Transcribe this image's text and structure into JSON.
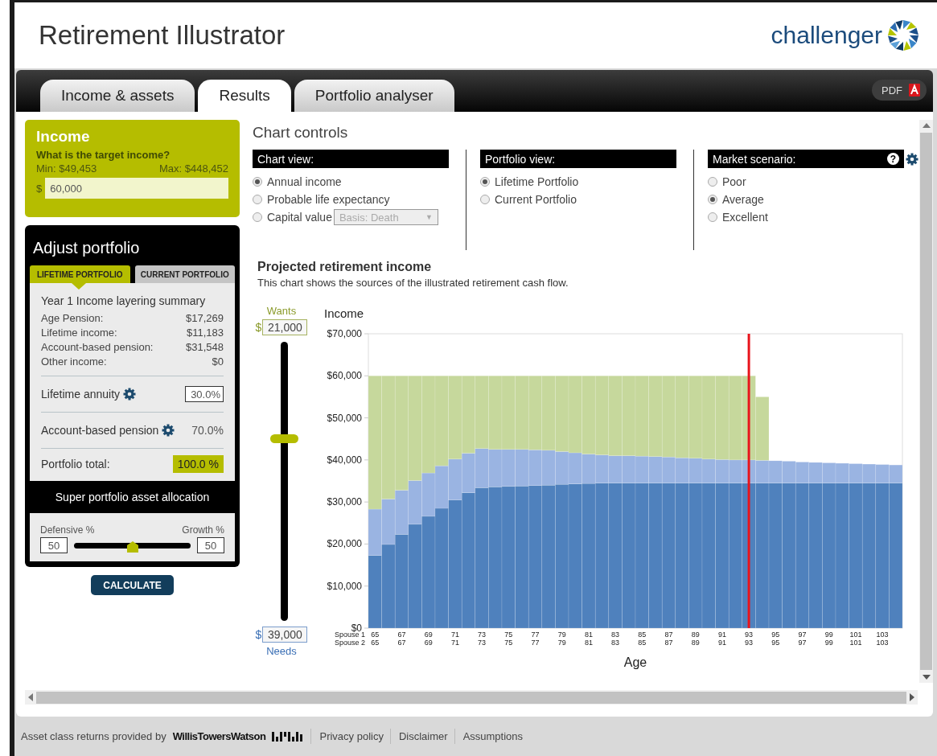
{
  "header": {
    "title": "Retirement Illustrator",
    "logo_text": "challenger"
  },
  "tabs": [
    {
      "label": "Income & assets",
      "selected": false
    },
    {
      "label": "Results",
      "selected": true
    },
    {
      "label": "Portfolio analyser",
      "selected": false
    }
  ],
  "pdf_button": {
    "label": "PDF"
  },
  "income": {
    "title": "Income",
    "question": "What is the target income?",
    "min": "Min: $49,453",
    "max": "Max: $448,452",
    "currency": "$",
    "value": "60,000"
  },
  "adjust_portfolio": {
    "title": "Adjust portfolio",
    "tabs": [
      {
        "label": "LIFETIME PORTFOLIO",
        "selected": true
      },
      {
        "label": "CURRENT PORTFOLIO",
        "selected": false
      }
    ],
    "summary_title": "Year 1 Income layering summary",
    "summary": [
      {
        "label": "Age Pension:",
        "value": "$17,269"
      },
      {
        "label": "Lifetime income:",
        "value": "$11,183"
      },
      {
        "label": "Account-based pension:",
        "value": "$31,548"
      },
      {
        "label": "Other income:",
        "value": "$0"
      }
    ],
    "allocations": [
      {
        "kind": "input",
        "label": "Lifetime annuity",
        "value": "30.0%"
      },
      {
        "kind": "text",
        "label": "Account-based pension",
        "value": "70.0%"
      }
    ],
    "total": {
      "label": "Portfolio total:",
      "value": "100.0 %"
    },
    "asset_allocation": {
      "title": "Super portfolio asset allocation",
      "left_label": "Defensive %",
      "right_label": "Growth %",
      "left_value": "50",
      "right_value": "50",
      "level": 0.5
    }
  },
  "calculate_button": {
    "label": "CALCULATE"
  },
  "chart_controls": {
    "title": "Chart controls",
    "groups": [
      {
        "title": "Chart view:",
        "options": [
          {
            "label": "Annual income",
            "selected": true
          },
          {
            "label": "Probable life expectancy",
            "selected": false
          },
          {
            "label": "Capital value",
            "selected": false,
            "dropdown": {
              "value": "Basis: Death",
              "caret": "▼",
              "disabled": true
            }
          }
        ]
      },
      {
        "title": "Portfolio view:",
        "options": [
          {
            "label": "Lifetime Portfolio",
            "selected": true
          },
          {
            "label": "Current Portfolio",
            "selected": false
          }
        ]
      },
      {
        "title": "Market scenario:",
        "help": "?",
        "options": [
          {
            "label": "Poor",
            "selected": false
          },
          {
            "label": "Average",
            "selected": true
          },
          {
            "label": "Excellent",
            "selected": false
          }
        ]
      }
    ]
  },
  "projection": {
    "title": "Projected retirement income",
    "description": "This chart shows the sources of the illustrated retirement cash flow."
  },
  "income_slider": {
    "top_label": "Wants",
    "top_currency": "$",
    "top_value": "21,000",
    "bottom_currency": "$",
    "bottom_value": "39,000",
    "bottom_label": "Needs",
    "level": 0.65
  },
  "chart_data": {
    "type": "bar",
    "stacked": true,
    "xlabel": "Age",
    "ylabel": "Income",
    "x": [
      65,
      66,
      67,
      68,
      69,
      70,
      71,
      72,
      73,
      74,
      75,
      76,
      77,
      78,
      79,
      80,
      81,
      82,
      83,
      84,
      85,
      86,
      87,
      88,
      89,
      90,
      91,
      92,
      93,
      94,
      95,
      96,
      97,
      98,
      99,
      100,
      101,
      102,
      103,
      104
    ],
    "xlim": [
      64.5,
      104.5
    ],
    "xticks": [
      65,
      67,
      69,
      71,
      73,
      75,
      77,
      79,
      81,
      83,
      85,
      87,
      89,
      91,
      93,
      95,
      97,
      99,
      101,
      103
    ],
    "ylim": [
      0,
      70000
    ],
    "yticks": [
      {
        "value": 0,
        "label": "$0"
      },
      {
        "value": 10000,
        "label": "$10,000"
      },
      {
        "value": 20000,
        "label": "$20,000"
      },
      {
        "value": 30000,
        "label": "$30,000"
      },
      {
        "value": 40000,
        "label": "$40,000"
      },
      {
        "value": 50000,
        "label": "$50,000"
      },
      {
        "value": 60000,
        "label": "$60,000"
      },
      {
        "value": 70000,
        "label": "$70,000"
      }
    ],
    "series": [
      {
        "color": "#4f81bd",
        "values": [
          17300,
          19900,
          22300,
          24700,
          26600,
          28500,
          30500,
          32200,
          33400,
          33600,
          33700,
          33800,
          33900,
          34000,
          34200,
          34300,
          34400,
          34500,
          34500,
          34500,
          34500,
          34500,
          34500,
          34500,
          34500,
          34500,
          34500,
          34500,
          34500,
          34500,
          34500,
          34500,
          34500,
          34500,
          34500,
          34500,
          34500,
          34500,
          34500,
          34500
        ]
      },
      {
        "color": "#9ab4e2",
        "values": [
          11000,
          10800,
          10500,
          10400,
          10300,
          10100,
          9700,
          9400,
          9300,
          8900,
          8800,
          8700,
          8500,
          8300,
          7800,
          7400,
          7000,
          6700,
          6500,
          6500,
          6400,
          6300,
          6200,
          6000,
          5900,
          5700,
          5600,
          5500,
          5500,
          5400,
          5300,
          5200,
          5000,
          4900,
          4800,
          4700,
          4600,
          4500,
          4400,
          4300
        ]
      },
      {
        "color": "#c6d89c",
        "values": [
          31700,
          29300,
          27200,
          24900,
          23100,
          21400,
          19800,
          18400,
          17300,
          17500,
          17500,
          17500,
          17600,
          17700,
          18000,
          18300,
          18600,
          18800,
          19000,
          19000,
          19100,
          19200,
          19300,
          19500,
          19600,
          19800,
          19900,
          20000,
          20000,
          15100,
          null,
          null,
          null,
          null,
          null,
          null,
          null,
          null,
          null,
          null
        ]
      }
    ],
    "ref_lines": [
      {
        "axis": "x",
        "value": 93,
        "color": "#e8141c"
      }
    ]
  },
  "age_axis": {
    "row_labels": [
      "Spouse 1",
      "Spouse 2"
    ],
    "spouse_2_ticks": [
      "65",
      "67",
      "69",
      "71",
      "73",
      "75",
      "77",
      "79",
      "81",
      "83",
      "85",
      "87",
      "89",
      "91",
      "93",
      "95",
      "97",
      "99",
      "101",
      "103"
    ]
  },
  "footer": {
    "credit": "Asset class returns provided by",
    "provider": "WillisTowersWatson",
    "links": [
      "Privacy policy",
      "Disclaimer",
      "Assumptions"
    ]
  }
}
